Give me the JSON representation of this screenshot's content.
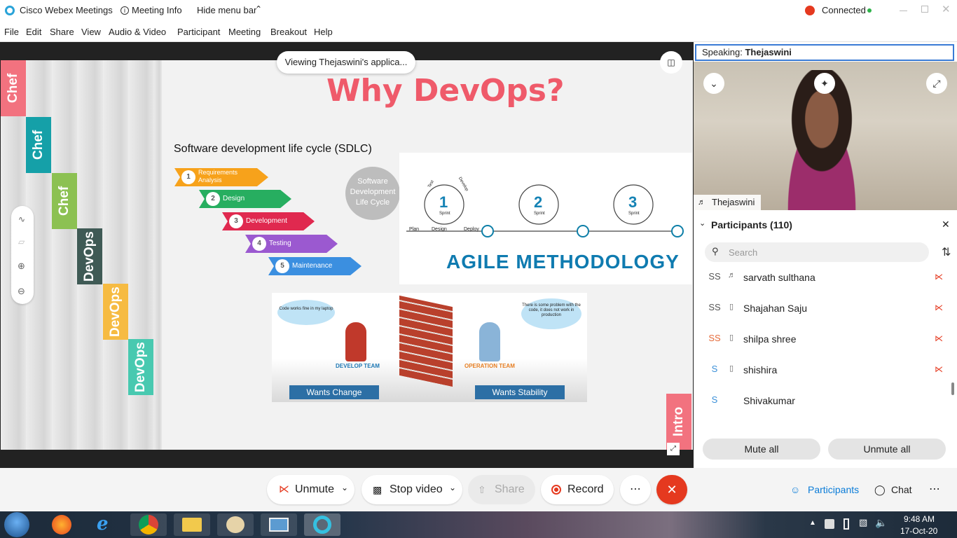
{
  "window": {
    "app_title": "Cisco Webex Meetings",
    "meeting_info": "Meeting Info",
    "hide_menu": "Hide menu bar",
    "status": "Connected"
  },
  "menu": [
    "File",
    "Edit",
    "Share",
    "View",
    "Audio & Video",
    "Participant",
    "Meeting",
    "Breakout",
    "Help"
  ],
  "share": {
    "viewing": "Viewing Thejaswini's applica...",
    "slide": {
      "title": "Why DevOps?",
      "sdlc_heading": "Software development life cycle (SDLC)",
      "sdlc_circle": "Software Development Life Cycle",
      "steps": [
        {
          "n": "1",
          "label": "Requirements Analysis"
        },
        {
          "n": "2",
          "label": "Design"
        },
        {
          "n": "3",
          "label": "Development"
        },
        {
          "n": "4",
          "label": "Testing"
        },
        {
          "n": "5",
          "label": "Maintenance"
        }
      ],
      "side_tabs": [
        "Chef",
        "Chef",
        "Chef",
        "DevOps",
        "DevOps",
        "DevOps"
      ],
      "intro_tab": "Intro",
      "agile_title": "AGILE METHODOLOGY",
      "sprints": [
        "1",
        "2",
        "3"
      ],
      "sprint_word": "Sprint",
      "phases": [
        "Plan",
        "Design",
        "Deploy"
      ],
      "arc_labels": [
        "Test",
        "Develop"
      ],
      "dev_team": "DEVELOP TEAM",
      "ops_team": "OPERATION TEAM",
      "dev_bubble": "Code works fine in my laptop",
      "ops_bubble": "There is some problem with the code, it does not work in production",
      "wants_change": "Wants Change",
      "wants_stability": "Wants Stability"
    }
  },
  "right": {
    "speaking_label": "Speaking:",
    "speaking_name": "Thejaswini",
    "video_name": "Thejaswini",
    "participants_title": "Participants (110)",
    "search_placeholder": "Search",
    "participants": [
      {
        "initials": "SS",
        "name": "sarvath sulthana"
      },
      {
        "initials": "SS",
        "name": "Shajahan Saju"
      },
      {
        "initials": "SS",
        "name": "shilpa shree"
      },
      {
        "initials": "S",
        "name": "shishira"
      },
      {
        "initials": "S",
        "name": "Shivakumar"
      }
    ],
    "mute_all": "Mute all",
    "unmute_all": "Unmute all"
  },
  "controls": {
    "unmute": "Unmute",
    "stop_video": "Stop video",
    "share": "Share",
    "record": "Record",
    "participants": "Participants",
    "chat": "Chat"
  },
  "taskbar": {
    "time": "9:48 AM",
    "date": "17-Oct-20"
  },
  "colors": {
    "accent": "#0a7cd8",
    "end_call": "#e5391f",
    "connected": "#2fb34a",
    "slide_title": "#ef5a6a"
  }
}
